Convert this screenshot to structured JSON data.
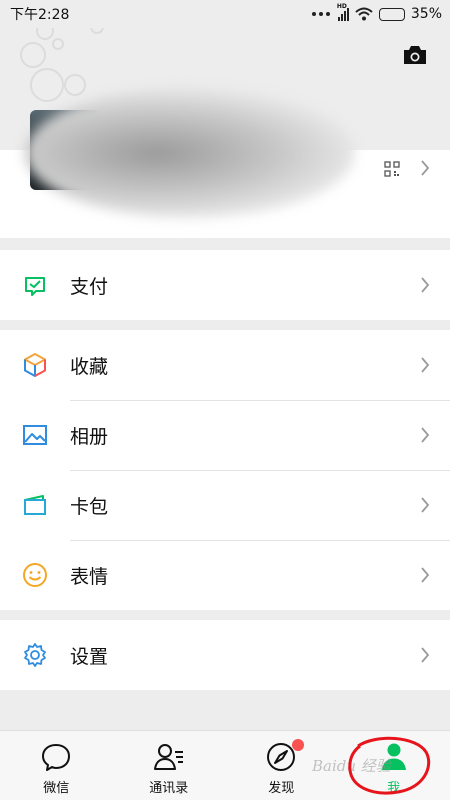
{
  "status_bar": {
    "time": "下午2:28",
    "network": "HD",
    "battery_percent": "35%",
    "battery_level": 0.35
  },
  "header": {
    "camera_icon": "camera-icon"
  },
  "profile": {
    "qr_icon": "qrcode-icon"
  },
  "groups": [
    {
      "items": [
        {
          "label": "支付",
          "icon": "wechat-pay-icon",
          "color": "#07c160"
        }
      ]
    },
    {
      "items": [
        {
          "label": "收藏",
          "icon": "favorites-cube-icon",
          "color": "#f2a33b"
        },
        {
          "label": "相册",
          "icon": "album-icon",
          "color": "#2f8ce0"
        },
        {
          "label": "卡包",
          "icon": "card-wallet-icon",
          "color": "#27a9d8"
        },
        {
          "label": "表情",
          "icon": "sticker-smile-icon",
          "color": "#f5a623"
        }
      ]
    },
    {
      "items": [
        {
          "label": "设置",
          "icon": "settings-gear-icon",
          "color": "#2f8ce0"
        }
      ]
    }
  ],
  "tabbar": {
    "tabs": [
      {
        "label": "微信",
        "icon": "chat-bubble-icon"
      },
      {
        "label": "通讯录",
        "icon": "contacts-icon"
      },
      {
        "label": "发现",
        "icon": "discover-compass-icon",
        "badge": "red-dot"
      },
      {
        "label": "我",
        "icon": "me-person-icon",
        "active": true
      }
    ],
    "active_color": "#07c160"
  },
  "watermark": "Baidu 经验"
}
